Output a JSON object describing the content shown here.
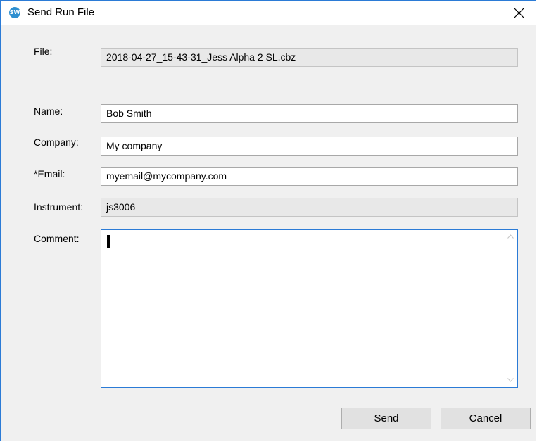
{
  "window": {
    "title": "Send Run File",
    "icon": "sw-app-icon",
    "close_icon": "close-icon"
  },
  "form": {
    "file": {
      "label": "File:",
      "value": "2018-04-27_15-43-31_Jess Alpha 2 SL.cbz"
    },
    "name": {
      "label": "Name:",
      "value": "Bob Smith"
    },
    "company": {
      "label": "Company:",
      "value": "My company"
    },
    "email": {
      "label": "*Email:",
      "value": "myemail@mycompany.com"
    },
    "instrument": {
      "label": "Instrument:",
      "value": "js3006"
    },
    "comment": {
      "label": "Comment:",
      "value": ""
    }
  },
  "buttons": {
    "send": "Send",
    "cancel": "Cancel"
  },
  "colors": {
    "accent": "#2b7bd6",
    "background": "#f0f0f0",
    "readonly_field": "#e8e8e8"
  }
}
